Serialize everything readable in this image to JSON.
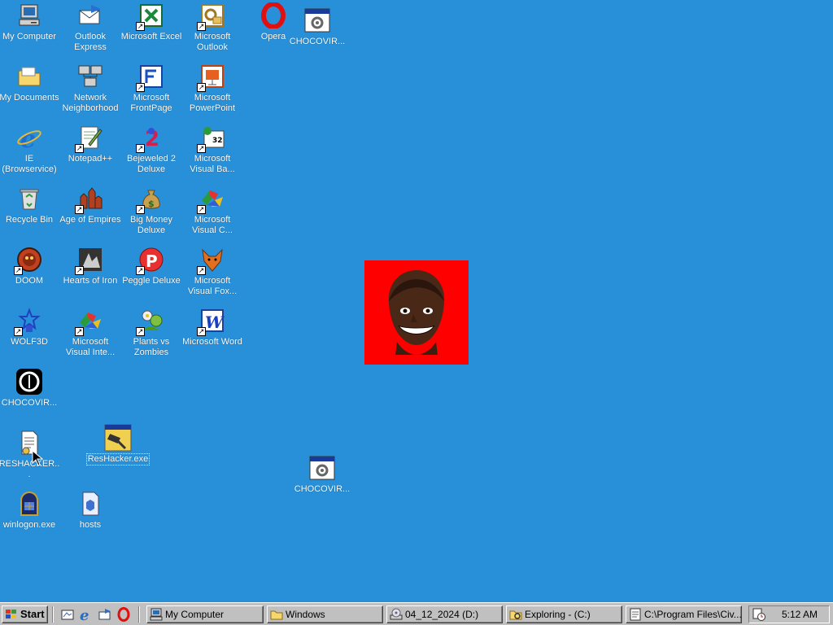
{
  "desktop": {
    "icons": {
      "my_computer": "My Computer",
      "outlook_express": "Outlook Express",
      "excel": "Microsoft Excel",
      "outlook": "Microsoft Outlook",
      "opera": "Opera",
      "choco1": "CHOCOVIR...",
      "my_documents": "My Documents",
      "network": "Network Neighborhood",
      "frontpage": "Microsoft FrontPage",
      "powerpoint": "Microsoft PowerPoint",
      "ie": "IE (Browservice)",
      "notepadpp": "Notepad++",
      "bejeweled": "Bejeweled 2 Deluxe",
      "visual_basic": "Microsoft Visual Ba...",
      "recycle": "Recycle Bin",
      "aoe": "Age of Empires",
      "bigmoney": "Big Money Deluxe",
      "visual_c": "Microsoft Visual C...",
      "doom": "DOOM",
      "hoi": "Hearts of Iron",
      "peggle": "Peggle Deluxe",
      "visual_fox": "Microsoft Visual Fox...",
      "wolf3d": "WOLF3D",
      "visual_inter": "Microsoft Visual Inte...",
      "pvz": "Plants vs Zombies",
      "word": "Microsoft Word",
      "choco2": "CHOCOVIR...",
      "reshacker_file": "RESHACKER...",
      "reshacker_exe": "ResHacker.exe",
      "choco3": "CHOCOVIR...",
      "winlogon": "winlogon.exe",
      "hosts": "hosts"
    }
  },
  "taskbar": {
    "start": "Start",
    "buttons": {
      "my_computer": "My Computer",
      "windows": "Windows",
      "drive": "04_12_2024 (D:)",
      "exploring": "Exploring -  (C:)",
      "program_files": "C:\\Program Files\\Civ..."
    },
    "clock": "5:12 AM"
  },
  "colors": {
    "desktop": "#2890d8",
    "taskbar": "#c0c0c0",
    "face_bg": "#ff0000"
  }
}
